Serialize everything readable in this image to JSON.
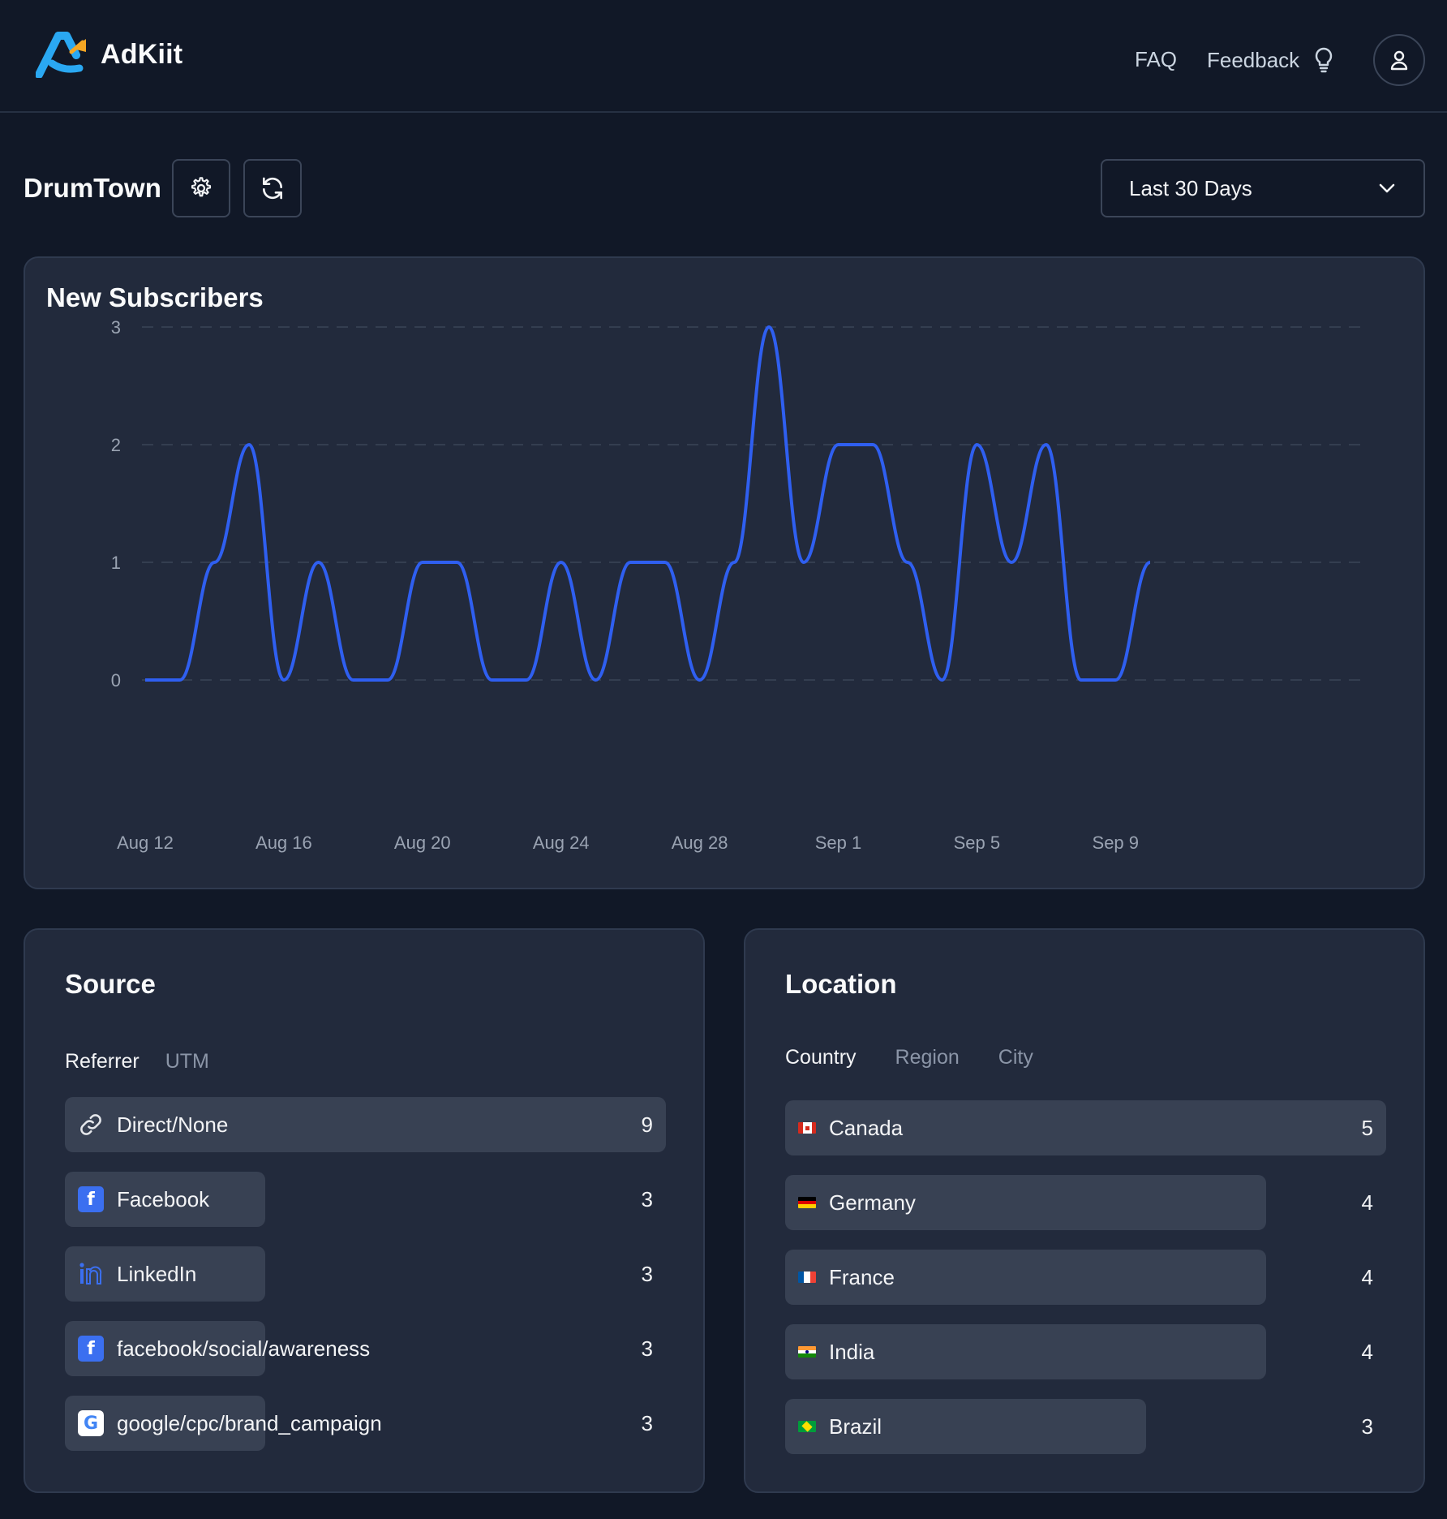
{
  "header": {
    "app_name": "AdKiit",
    "nav": {
      "faq": "FAQ",
      "feedback": "Feedback"
    }
  },
  "toolbar": {
    "title": "DrumTown",
    "date_range": "Last 30 Days"
  },
  "chart_card": {
    "title": "New Subscribers"
  },
  "chart_data": {
    "type": "line",
    "title": "New Subscribers",
    "color": "#2f5ff0",
    "x": [
      "Aug 12",
      "Aug 13",
      "Aug 14",
      "Aug 15",
      "Aug 16",
      "Aug 17",
      "Aug 18",
      "Aug 19",
      "Aug 20",
      "Aug 21",
      "Aug 22",
      "Aug 23",
      "Aug 24",
      "Aug 25",
      "Aug 26",
      "Aug 27",
      "Aug 28",
      "Aug 29",
      "Aug 30",
      "Aug 31",
      "Sep 1",
      "Sep 2",
      "Sep 3",
      "Sep 4",
      "Sep 5",
      "Sep 6",
      "Sep 7",
      "Sep 8",
      "Sep 9",
      "Sep 10"
    ],
    "values": [
      0,
      0,
      1,
      2,
      0,
      1,
      0,
      0,
      1,
      1,
      0,
      0,
      1,
      0,
      1,
      1,
      0,
      1,
      3,
      1,
      2,
      2,
      1,
      0,
      2,
      1,
      2,
      0,
      0,
      1
    ],
    "x_tick_labels": [
      "Aug 12",
      "Aug 16",
      "Aug 20",
      "Aug 24",
      "Aug 28",
      "Sep 1",
      "Sep 5",
      "Sep 9"
    ],
    "y_ticks": [
      "0",
      "1",
      "2",
      "3"
    ],
    "ylim": [
      0,
      3
    ],
    "grid": "horizontal-dashed"
  },
  "source": {
    "title": "Source",
    "tabs": [
      "Referrer",
      "UTM"
    ],
    "active_tab": "Referrer",
    "rows": [
      {
        "icon": "link-icon",
        "label": "Direct/None",
        "value": 9
      },
      {
        "icon": "facebook-icon",
        "label": "Facebook",
        "value": 3
      },
      {
        "icon": "linkedin-icon",
        "label": "LinkedIn",
        "value": 3
      },
      {
        "icon": "facebook-icon",
        "label": "facebook/social/awareness",
        "value": 3
      },
      {
        "icon": "google-icon",
        "label": "google/cpc/brand_campaign",
        "value": 3
      }
    ]
  },
  "location": {
    "title": "Location",
    "tabs": [
      "Country",
      "Region",
      "City"
    ],
    "active_tab": "Country",
    "rows": [
      {
        "icon": "canada-flag-icon",
        "label": "Canada",
        "value": 5
      },
      {
        "icon": "germany-flag-icon",
        "label": "Germany",
        "value": 4
      },
      {
        "icon": "france-flag-icon",
        "label": "France",
        "value": 4
      },
      {
        "icon": "india-flag-icon",
        "label": "India",
        "value": 4
      },
      {
        "icon": "brazil-flag-icon",
        "label": "Brazil",
        "value": 3
      }
    ]
  }
}
